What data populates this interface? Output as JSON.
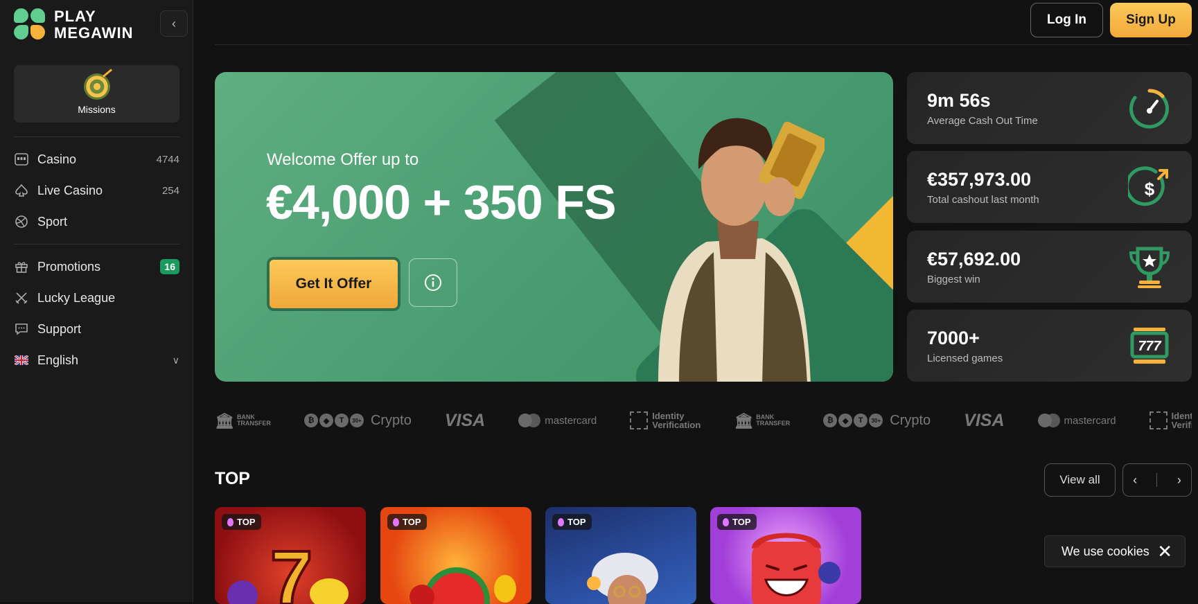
{
  "brand": {
    "line1": "PLAY",
    "line2": "MEGAWIN"
  },
  "sidebar": {
    "missions_label": "Missions",
    "items": [
      {
        "label": "Casino",
        "count": "4744",
        "icon": "casino-icon"
      },
      {
        "label": "Live Casino",
        "count": "254",
        "icon": "spade-icon"
      },
      {
        "label": "Sport",
        "icon": "sport-ball-icon"
      },
      {
        "label": "Promotions",
        "badge": "16",
        "icon": "gift-icon"
      },
      {
        "label": "Lucky League",
        "icon": "crossed-swords-icon"
      },
      {
        "label": "Support",
        "icon": "chat-icon"
      },
      {
        "label": "English",
        "icon": "uk-flag-icon"
      }
    ]
  },
  "header": {
    "login": "Log In",
    "signup": "Sign Up"
  },
  "hero": {
    "subtitle": "Welcome Offer up to",
    "title": "€4,000 + 350 FS",
    "cta": "Get It Offer"
  },
  "stats": [
    {
      "value": "9m 56s",
      "label": "Average Cash Out Time",
      "icon": "speedometer-icon"
    },
    {
      "value": "€357,973.00",
      "label": "Total cashout last month",
      "icon": "dollar-arrow-icon"
    },
    {
      "value": "€57,692.00",
      "label": "Biggest win",
      "icon": "trophy-icon"
    },
    {
      "value": "7000+",
      "label": "Licensed games",
      "icon": "slot-777-icon"
    }
  ],
  "payments": {
    "bank_line1": "BANK",
    "bank_line2": "TRANSFER",
    "crypto": "Crypto",
    "crypto_more": "30+",
    "visa": "VISA",
    "mastercard": "mastercard",
    "id_line1": "Identity",
    "id_line2": "Verification"
  },
  "games_section": {
    "title": "TOP",
    "view_all": "View all",
    "tag": "TOP"
  },
  "cookie": {
    "text": "We use cookies"
  },
  "colors": {
    "accent_green": "#1a9a5e",
    "accent_yellow": "#f7b23b",
    "background": "#121212"
  }
}
